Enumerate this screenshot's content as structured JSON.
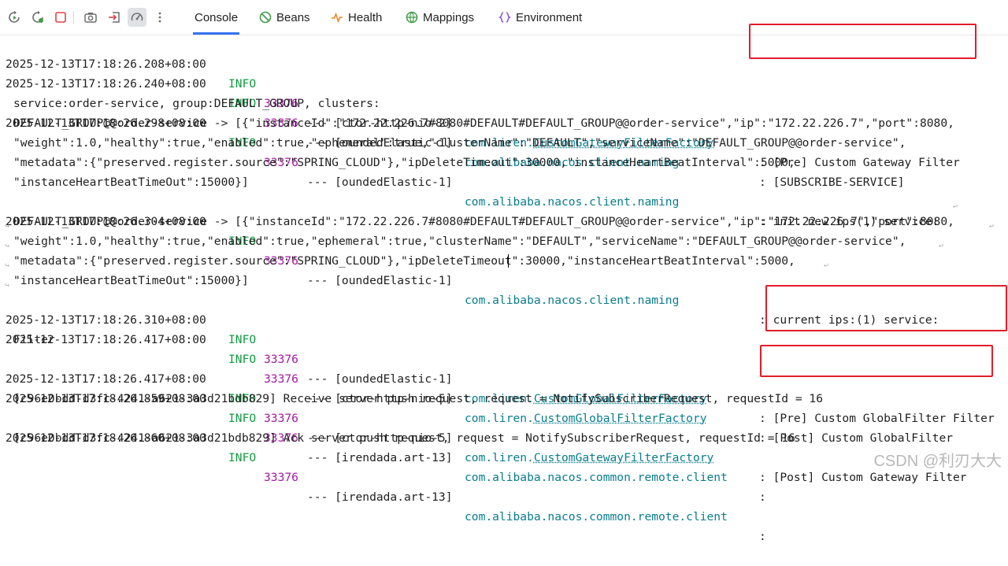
{
  "toolbar": {
    "icons": [
      "rerun-icon",
      "rerun-failed-icon",
      "stop-icon",
      "screenshot-icon",
      "exit-icon",
      "performance-icon",
      "more-icon"
    ],
    "tabs": [
      {
        "label": "Console",
        "icon": "none"
      },
      {
        "label": "Beans",
        "icon": "beans-icon"
      },
      {
        "label": "Health",
        "icon": "health-icon"
      },
      {
        "label": "Mappings",
        "icon": "mappings-icon"
      },
      {
        "label": "Environment",
        "icon": "environment-icon"
      }
    ],
    "active_tab": "Console"
  },
  "colors": {
    "info": "#119c40",
    "pid": "#a31aa3",
    "logger": "#0a7d8c",
    "highlight": "#e11d2a",
    "tab_underline": "#3574f0"
  },
  "log": {
    "l1": {
      "ts": "2025-12-13T17:18:26.208+08:00",
      "lvl": "INFO",
      "pid": "33376",
      "thr": "--- [ctor-http-nio-2]",
      "lg_a": "com.liren.",
      "lg_b": "CustomGatewayFilterFactory",
      "msg": ": [Pre] Custom Gateway Filter"
    },
    "l2": {
      "ts": "2025-12-13T17:18:26.240+08:00",
      "lvl": "INFO",
      "pid": "33376",
      "thr": "--- [oundedElastic-1]",
      "lg": "com.alibaba.nacos.client.naming",
      "msg": ": [SUBSCRIBE-SERVICE]"
    },
    "l3": {
      "text": "service:order-service, group:DEFAULT_GROUP, clusters:"
    },
    "l4": {
      "ts": "2025-12-13T17:18:26.298+08:00",
      "lvl": "INFO",
      "pid": "33376",
      "thr": "--- [oundedElastic-1]",
      "lg": "com.alibaba.nacos.client.naming",
      "msg": ": init new ips(1) service:"
    },
    "l5": {
      "text": "DEFAULT_GROUP@@order-service -> [{\"instanceId\":\"172.22.226.7#8080#DEFAULT#DEFAULT_GROUP@@order-service\",\"ip\":\"172.22.226.7\",\"port\":8080,"
    },
    "l6": {
      "text": "\"weight\":1.0,\"healthy\":true,\"enabled\":true,\"ephemeral\":true,\"clusterName\":\"DEFAULT\",\"serviceName\":\"DEFAULT_GROUP@@order-service\","
    },
    "l7": {
      "text": "\"metadata\":{\"preserved.register.source\":\"SPRING_CLOUD\"},\"ipDeleteTimeout\":30000,\"instanceHeartBeatInterval\":5000,"
    },
    "l8": {
      "text": "\"instanceHeartBeatTimeOut\":15000}]"
    },
    "l9": {
      "ts": "2025-12-13T17:18:26.304+08:00",
      "lvl": "INFO",
      "pid": "33376",
      "thr": "--- [oundedElastic-1]",
      "lg": "com.alibaba.nacos.client.naming",
      "msg": ": current ips:(1) service:"
    },
    "l10": {
      "text": "DEFAULT_GROUP@@order-service -> [{\"instanceId\":\"172.22.226.7#8080#DEFAULT#DEFAULT_GROUP@@order-service\",\"ip\":\"172.22.226.7\",\"port\":8080,"
    },
    "l11": {
      "text": "\"weight\":1.0,\"healthy\":true,\"enabled\":true,\"ephemeral\":true,\"clusterName\":\"DEFAULT\",\"serviceName\":\"DEFAULT_GROUP@@order-service\","
    },
    "l12": {
      "text": "\"metadata\":{\"preserved.register.source\":\"SPRING_CLOUD\"},\"ipDeleteTimeout\":30000,\"instanceHeartBeatInterval\":5000,"
    },
    "l13": {
      "text": "\"instanceHeartBeatTimeOut\":15000}]"
    },
    "l14": {
      "ts": "2025-12-13T17:18:26.310+08:00",
      "lvl": "INFO",
      "pid": "33376",
      "thr": "--- [oundedElastic-1]",
      "lg_a": "com.liren.",
      "lg_b": "CustomGlobalFilterFactory",
      "msg": ": [Pre] Custom GlobalFilter Filter"
    },
    "l15": {
      "ts": "2025-12-13T17:18:26.417+08:00",
      "lvl": "INFO",
      "pid": "33376",
      "thr": "--- [ctor-http-nio-5]",
      "lg_a": "com.liren.",
      "lg_b": "CustomGlobalFilterFactory",
      "msg": ": [Post] Custom GlobalFilter"
    },
    "l16": {
      "text": "Filter"
    },
    "l17": {
      "ts": "2025-12-13T17:18:26.417+08:00",
      "lvl": "INFO",
      "pid": "33376",
      "thr": "--- [ctor-http-nio-5]",
      "lg_a": "com.liren.",
      "lg_b": "CustomGatewayFilterFactory",
      "msg": ": [Post] Custom Gateway Filter"
    },
    "l18": {
      "ts": "2025-12-13T17:18:26.859+08:00",
      "lvl": "INFO",
      "pid": "33376",
      "thr": "--- [irendada.art-13]",
      "lg": "com.alibaba.nacos.common.remote.client",
      "msg": ":"
    },
    "l19": {
      "text": "[c96e0bdd-d3fc-4241-a621-3a3d21bdb829] Receive server push request, request = NotifySubscriberRequest, requestId = 16"
    },
    "l20": {
      "ts": "2025-12-13T17:18:26.860+08:00",
      "lvl": "INFO",
      "pid": "33376",
      "thr": "--- [irendada.art-13]",
      "lg": "com.alibaba.nacos.common.remote.client",
      "msg": ":"
    },
    "l21": {
      "text": "[c96e0bdd-d3fc-4241-a621-3a3d21bdb829] Ack server push request, request = NotifySubscriberRequest, requestId = 16"
    }
  },
  "watermark": "CSDN @利刃大大"
}
